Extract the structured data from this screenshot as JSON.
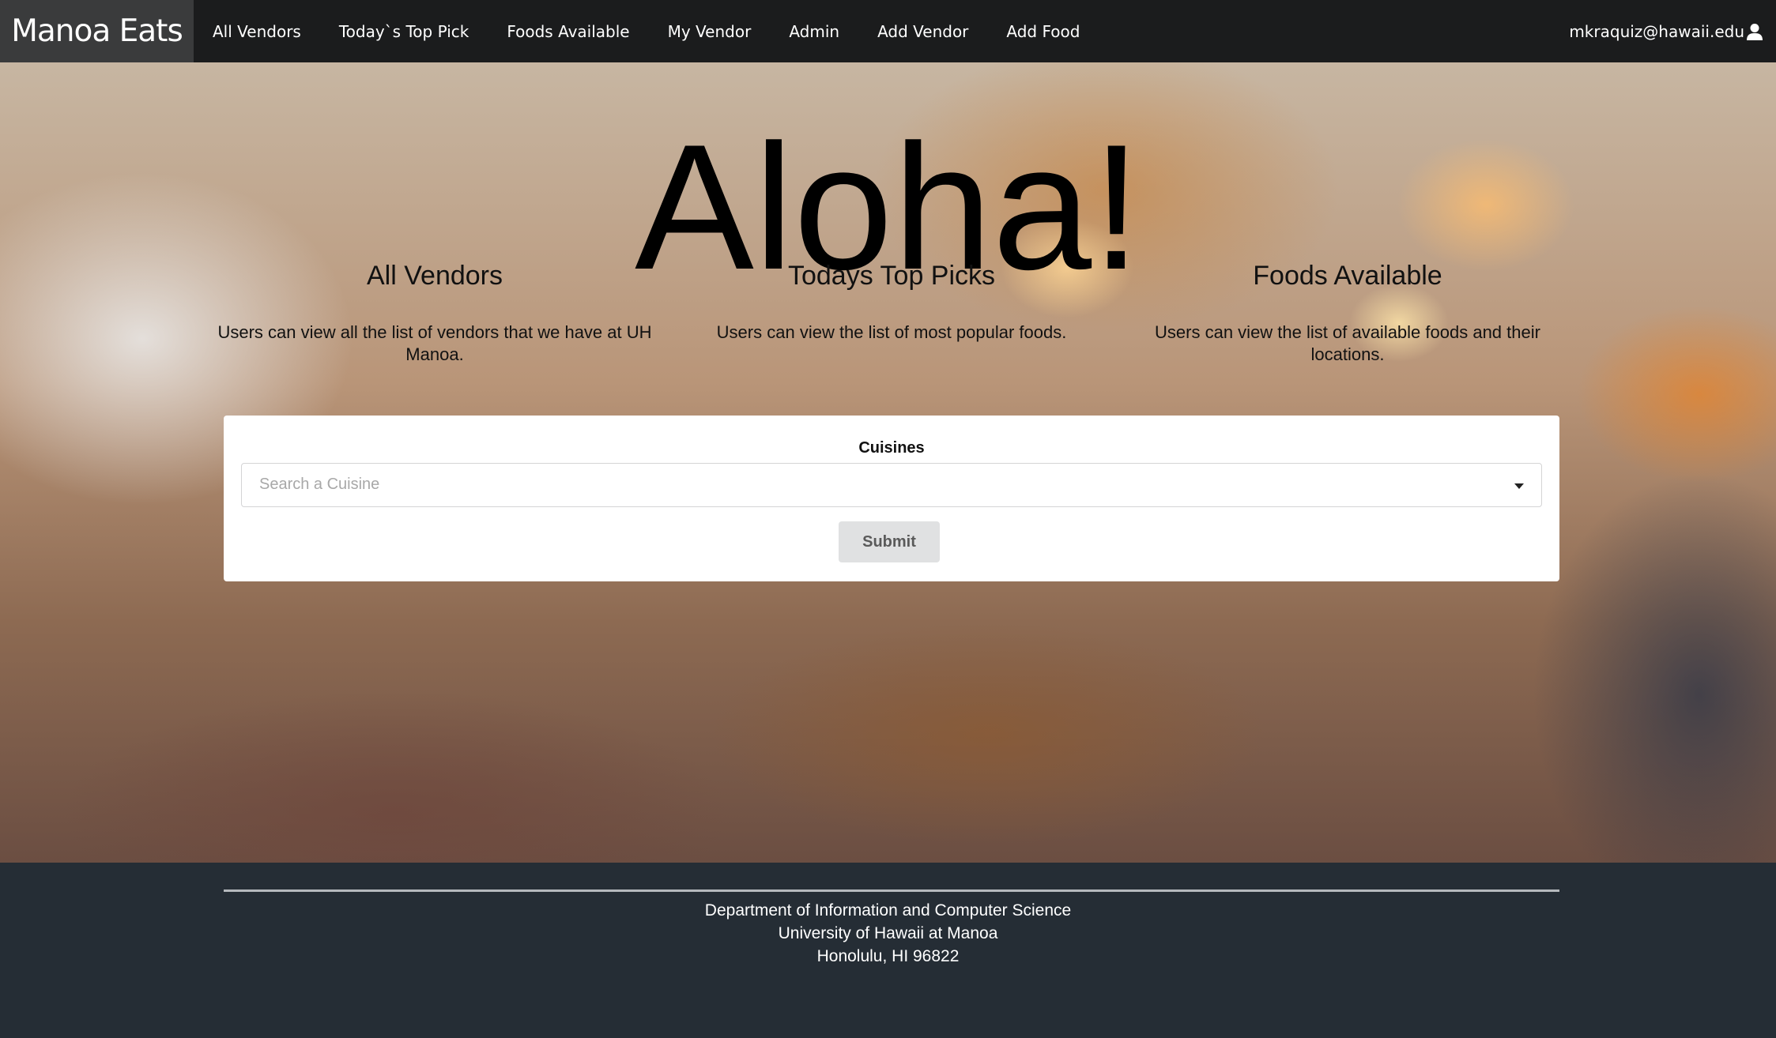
{
  "navbar": {
    "brand": "Manoa Eats",
    "items": [
      {
        "label": "All Vendors"
      },
      {
        "label": "Today`s Top Pick"
      },
      {
        "label": "Foods Available"
      },
      {
        "label": "My Vendor"
      },
      {
        "label": "Admin"
      },
      {
        "label": "Add Vendor"
      },
      {
        "label": "Add Food"
      }
    ],
    "user_email": "mkraquiz@hawaii.edu",
    "user_icon": "user-icon"
  },
  "hero": {
    "headline": "Aloha!",
    "features": [
      {
        "title": "All Vendors",
        "description": "Users can view all the list of vendors that we have at UH Manoa."
      },
      {
        "title": "Todays Top Picks",
        "description": "Users can view the list of most popular foods."
      },
      {
        "title": "Foods Available",
        "description": "Users can view the list of available foods and their locations."
      }
    ]
  },
  "search": {
    "label": "Cuisines",
    "placeholder": "Search a Cuisine",
    "submit_label": "Submit"
  },
  "footer": {
    "line1": "Department of Information and Computer Science",
    "line2": "University of Hawaii at Manoa",
    "line3": "Honolulu, HI 96822"
  }
}
